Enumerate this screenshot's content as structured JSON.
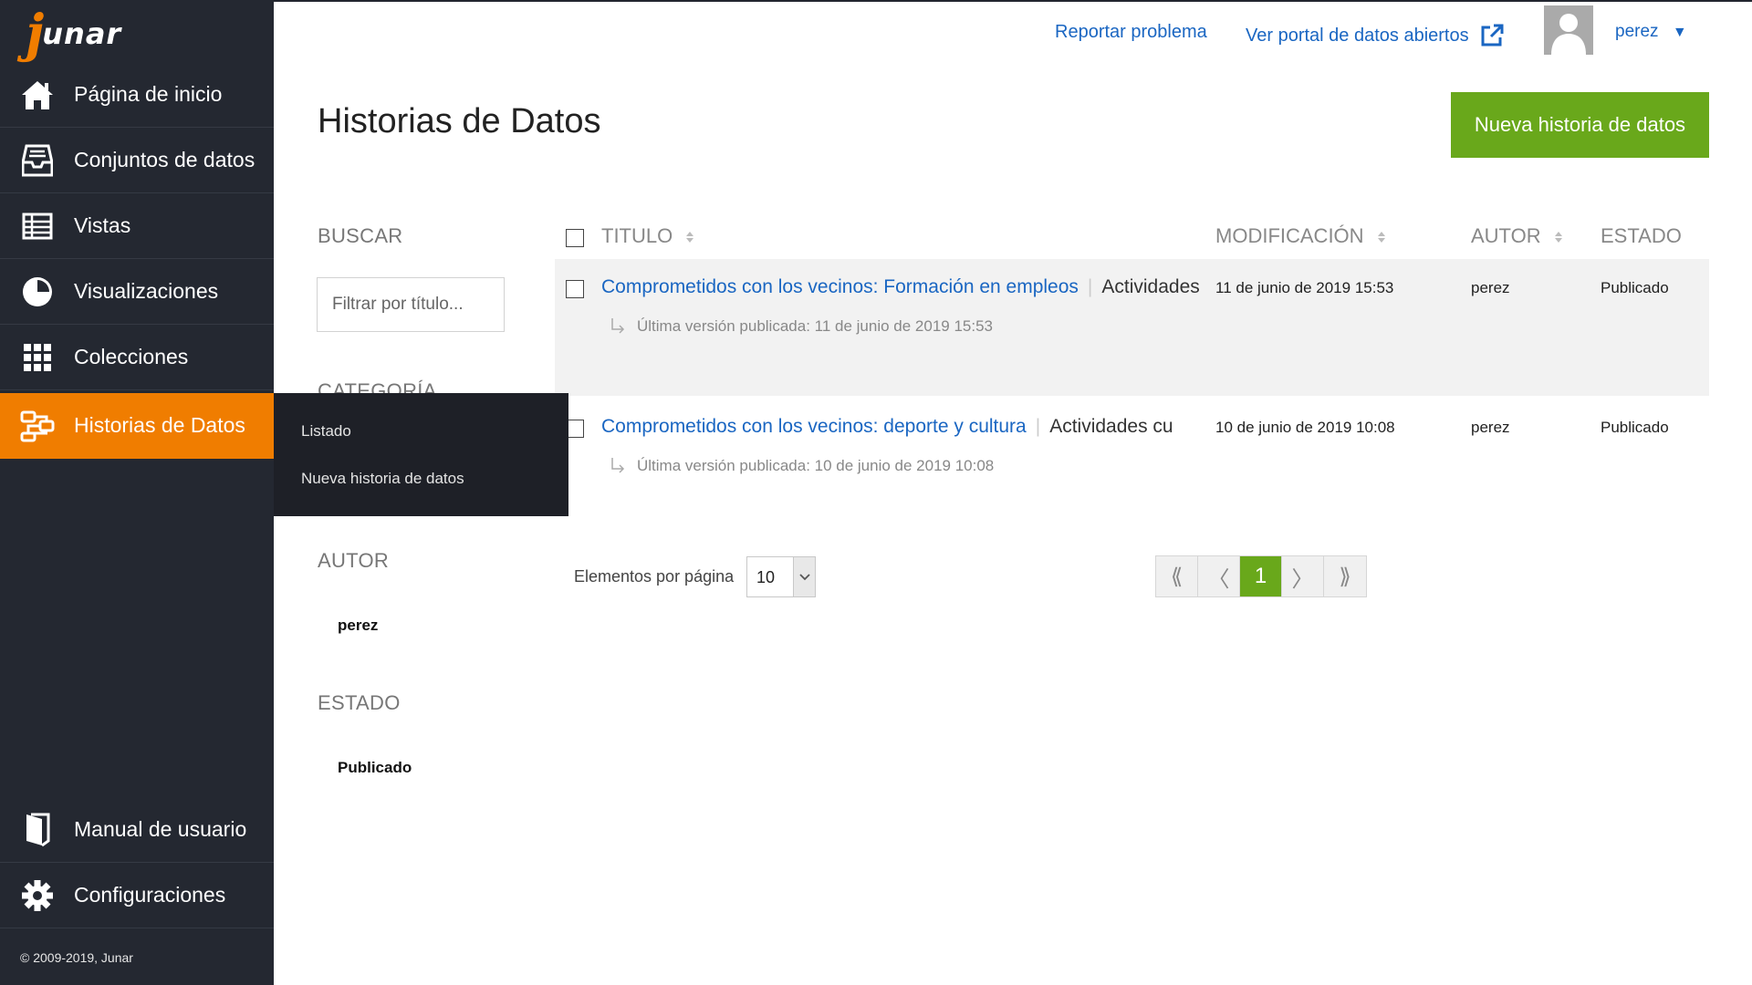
{
  "brand": {
    "logo_letter": "j",
    "logo_text": "unar"
  },
  "sidebar": {
    "items": [
      {
        "label": "Página de inicio",
        "icon": "home-icon"
      },
      {
        "label": "Conjuntos de datos",
        "icon": "inbox-icon"
      },
      {
        "label": "Vistas",
        "icon": "table-icon"
      },
      {
        "label": "Visualizaciones",
        "icon": "pie-chart-icon"
      },
      {
        "label": "Colecciones",
        "icon": "grid-icon"
      },
      {
        "label": "Historias de Datos",
        "icon": "story-icon",
        "active": true
      },
      {
        "label": "Manual de usuario",
        "icon": "book-icon"
      },
      {
        "label": "Configuraciones",
        "icon": "gear-icon"
      }
    ],
    "submenu": [
      "Listado",
      "Nueva historia de datos"
    ],
    "footer": "© 2009-2019, Junar"
  },
  "topbar": {
    "report_label": "Reportar problema",
    "portal_label": "Ver portal de datos abiertos",
    "user_name": "perez",
    "user_caret": "▼"
  },
  "page": {
    "title": "Historias de Datos",
    "new_button": "Nueva historia de datos"
  },
  "filters": {
    "search_heading": "BUSCAR",
    "search_placeholder": "Filtrar por título...",
    "category_heading": "CATEGORÍA",
    "author_heading": "AUTOR",
    "author_value": "perez",
    "status_heading": "ESTADO",
    "status_value": "Publicado"
  },
  "table": {
    "headers": {
      "title": "TITULO",
      "modified": "MODIFICACIÓN",
      "author": "AUTOR",
      "status": "ESTADO"
    },
    "rows": [
      {
        "title": "Comprometidos con los vecinos: Formación en empleos",
        "category": "Actividades",
        "last_published": "Última versión publicada: 11 de junio de 2019 15:53",
        "modified": "11 de junio de 2019 15:53",
        "author": "perez",
        "status": "Publicado"
      },
      {
        "title": "Comprometidos con los vecinos: deporte y cultura",
        "category": "Actividades cu",
        "last_published": "Última versión publicada: 10 de junio de 2019 10:08",
        "modified": "10 de junio de 2019 10:08",
        "author": "perez",
        "status": "Publicado"
      }
    ]
  },
  "pagination": {
    "per_page_label": "Elementos por página",
    "per_page_value": "10",
    "current_page": "1",
    "first": "⟪",
    "prev": "〈",
    "next": "〉",
    "last": "⟫"
  }
}
